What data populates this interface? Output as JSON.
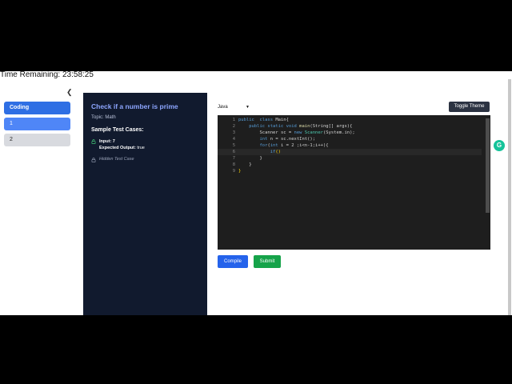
{
  "timer": {
    "label": "Time Remaining: 23:58:25"
  },
  "sidebar": {
    "collapse_icon": "chevron-left-icon",
    "items": [
      {
        "label": "Coding"
      },
      {
        "label": "1"
      },
      {
        "label": "2"
      }
    ]
  },
  "problem": {
    "title": "Check if a number is prime",
    "topic": "Topic: Math",
    "sample_heading": "Sample Test Cases:",
    "case1": {
      "input": "Input: 7",
      "output_label": "Expected Output:",
      "output_value": "true"
    },
    "hidden_case": "Hidden Test Case"
  },
  "editor": {
    "language": "Java",
    "toggle_label": "Toggle Theme",
    "compile_label": "Compile",
    "submit_label": "Submit",
    "lines": [
      {
        "n": "1",
        "parts": [
          [
            "kw",
            "public"
          ],
          [
            "",
            "  "
          ],
          [
            "kw",
            "class"
          ],
          [
            "",
            " Main{"
          ]
        ]
      },
      {
        "n": "2",
        "parts": [
          [
            "",
            "    "
          ],
          [
            "kw",
            "public static void"
          ],
          [
            "",
            " "
          ],
          [
            "fn",
            "main"
          ],
          [
            "",
            "(String[] args){"
          ]
        ]
      },
      {
        "n": "3",
        "parts": [
          [
            "",
            "        Scanner sc = "
          ],
          [
            "kw",
            "new"
          ],
          [
            "",
            " "
          ],
          [
            "cls",
            "Scanner"
          ],
          [
            "",
            "(System.in);"
          ]
        ]
      },
      {
        "n": "4",
        "parts": [
          [
            "",
            "        "
          ],
          [
            "kw",
            "int"
          ],
          [
            "",
            " n = sc.nextInt();"
          ]
        ]
      },
      {
        "n": "5",
        "parts": [
          [
            "",
            "        "
          ],
          [
            "kw",
            "for"
          ],
          [
            "",
            "("
          ],
          [
            "kw",
            "int"
          ],
          [
            "",
            " i = 2 ;i<n-1;i++){"
          ]
        ]
      },
      {
        "n": "6",
        "parts": [
          [
            "",
            "            "
          ],
          [
            "kw",
            "if"
          ],
          [
            "br",
            "()"
          ]
        ]
      },
      {
        "n": "7",
        "parts": [
          [
            "",
            "        }"
          ]
        ]
      },
      {
        "n": "8",
        "parts": [
          [
            "",
            "    }"
          ]
        ]
      },
      {
        "n": "9",
        "parts": [
          [
            "br",
            "}"
          ]
        ]
      }
    ]
  },
  "extension": {
    "label": "G"
  }
}
